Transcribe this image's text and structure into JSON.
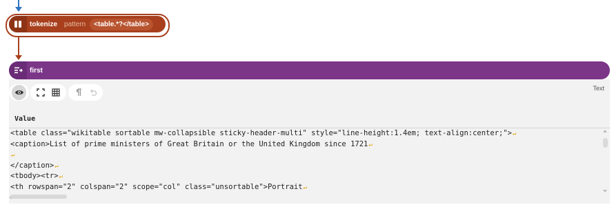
{
  "tokenize_node": {
    "name": "tokenize",
    "param_label": "pattern",
    "param_value": "<table.*?</table>",
    "icon": "tokenize-icon",
    "color": "#a8401d"
  },
  "first_node": {
    "name": "first",
    "icon": "first-list-icon",
    "color": "#7b3688"
  },
  "output_panel": {
    "type_label": "Text",
    "value_header": "Value",
    "toolbar": {
      "preview": "eye-icon",
      "fullscreen": "expand-icon",
      "table": "grid-icon",
      "pilcrow": "pilcrow-icon",
      "undo": "undo-icon"
    },
    "lines": [
      "<table class=\"wikitable sortable mw-collapsible sticky-header-multi\" style=\"line-height:1.4em; text-align:center;\">",
      "<caption>List of prime ministers of Great Britain or the United Kingdom since 1721",
      "",
      "</caption>",
      "<tbody><tr>",
      "<th rowspan=\"2\" colspan=\"2\" scope=\"col\" class=\"unsortable\">Portrait"
    ],
    "newline_glyph": "↵"
  }
}
